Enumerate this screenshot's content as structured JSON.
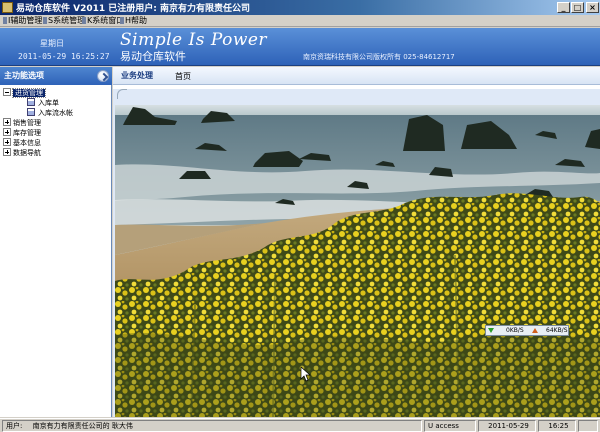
{
  "window": {
    "title": "易动仓库软件 V2011 已注册用户: 南京有力有限责任公司",
    "controls": {
      "minimize": "_",
      "maximize": "□",
      "close": "×"
    }
  },
  "menu": [
    {
      "key": "I",
      "label": "辅助管理"
    },
    {
      "key": "S",
      "label": "系统管理"
    },
    {
      "key": "K",
      "label": "系统窗口"
    },
    {
      "key": "H",
      "label": "帮助"
    }
  ],
  "header": {
    "weekday": "星期日",
    "datetime": "2011-05-29 16:25:27",
    "slogan": "Simple Is Power",
    "app_name": "易动仓库软件",
    "copyright": "南京资瑞科技有限公司版权所有 025-84612717"
  },
  "sidebar": {
    "title": "主功能选项",
    "items": [
      {
        "label": "进货管理",
        "expanded": true,
        "selected": true,
        "children": [
          {
            "label": "入库单"
          },
          {
            "label": "入库流水帐"
          }
        ]
      },
      {
        "label": "销售管理",
        "expanded": false,
        "children": []
      },
      {
        "label": "库存管理",
        "expanded": false,
        "children": []
      },
      {
        "label": "基本信息",
        "expanded": false,
        "children": []
      },
      {
        "label": "数据导航",
        "expanded": false,
        "children": []
      }
    ]
  },
  "main": {
    "section_label": "业务处理",
    "tab_home": "首页"
  },
  "netmeter": {
    "down": "0KB/S",
    "up": "64KB/S"
  },
  "statusbar": {
    "user_label": "用户:",
    "user_value": "南京有力有限责任公司的  耿大伟",
    "access": "U access",
    "date": "2011-05-29",
    "time": "16:25"
  },
  "colors": {
    "title_bar": "#0a246a",
    "header_bar": "#2e62b8",
    "flowers": "#e8d020",
    "sea": "#6f8a96",
    "sand": "#c8ad78"
  }
}
